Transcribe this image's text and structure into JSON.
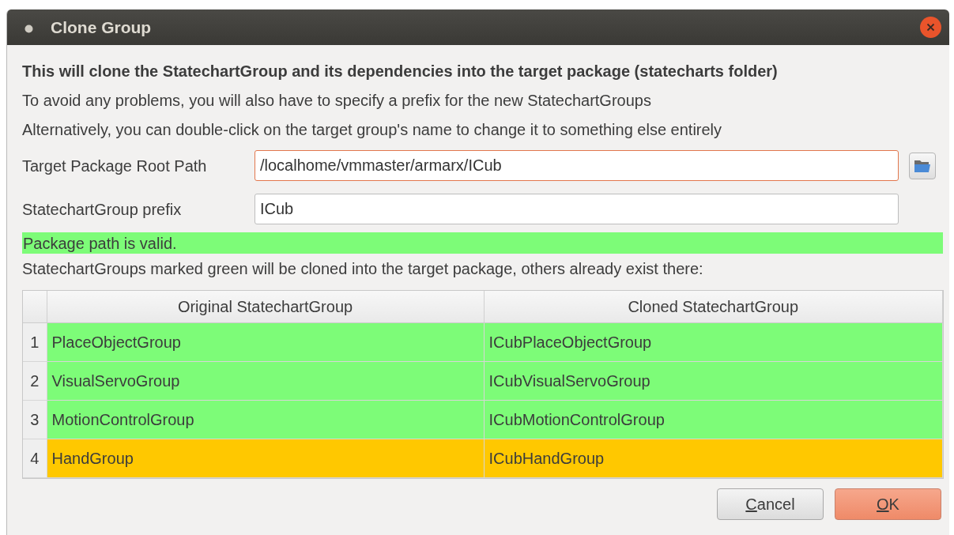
{
  "window": {
    "title": "Clone Group"
  },
  "intro": {
    "heading": "This will clone the StatechartGroup and its dependencies into the target package (statecharts folder)",
    "lines": [
      "To avoid any problems, you will also have to specify a prefix for the new StatechartGroups",
      "Alternatively, you can double-click on the target group's name to change it to something else entirely"
    ]
  },
  "fields": [
    {
      "label": "Target Package Root Path",
      "value": "/localhome/vmmaster/armarx/ICub",
      "focused": true,
      "browse": true
    },
    {
      "label": "StatechartGroup prefix",
      "value": "ICub",
      "focused": false,
      "browse": false
    }
  ],
  "status": {
    "text": "Package path is valid.",
    "color": "#7dfc78"
  },
  "table_caption": "StatechartGroups marked green will be cloned into the target package, others already exist there:",
  "table": {
    "columns": [
      "Original StatechartGroup",
      "Cloned StatechartGroup"
    ],
    "rows": [
      {
        "number": "1",
        "cells": [
          "PlaceObjectGroup",
          "ICubPlaceObjectGroup"
        ],
        "color": "#7dfc78"
      },
      {
        "number": "2",
        "cells": [
          "VisualServoGroup",
          "ICubVisualServoGroup"
        ],
        "color": "#7dfc78"
      },
      {
        "number": "3",
        "cells": [
          "MotionControlGroup",
          "ICubMotionControlGroup"
        ],
        "color": "#7dfc78"
      },
      {
        "number": "4",
        "cells": [
          "HandGroup",
          "ICubHandGroup"
        ],
        "color": "#ffc800"
      }
    ]
  },
  "buttons": [
    {
      "label": "Cancel",
      "kind": "secondary",
      "mnemonic_first": true
    },
    {
      "label": "OK",
      "kind": "default",
      "mnemonic_first": true
    }
  ]
}
